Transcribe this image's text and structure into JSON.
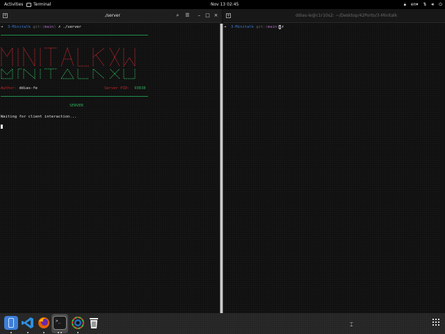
{
  "topbar": {
    "activities": "Activities",
    "app_name": "Terminal",
    "clock": "Nov 13  02:45",
    "lang": "en",
    "tray_icons": [
      "lock-icon",
      "keyboard-layout-icon",
      "network-icon",
      "volume-icon",
      "power-icon"
    ]
  },
  "terminal": {
    "left_tab": {
      "title": "./server"
    },
    "right_tab": {
      "title": "ddias-le@c1r10s2: ~/Desktop/42Porto/3-Minitalk"
    },
    "left_pane": {
      "prompt": {
        "arrow": "➜",
        "dir": "3-Minitalk",
        "git": "git:(",
        "branch": "main",
        "close": ")",
        "sep": "✗",
        "command": "./server"
      },
      "author_label": "Author:",
      "author_value": "ddias-fe",
      "pid_label": "Server PID:",
      "pid_value": "93838",
      "server_title": "SERVER",
      "status": "Waiting for client interaction..."
    },
    "right_pane": {
      "prompt": {
        "arrow": "➜",
        "dir": "3-Minitalk",
        "git": "git:(",
        "branch": "main",
        "close": ")",
        "sep": "✗"
      }
    }
  },
  "dock": {
    "items": [
      "files-icon",
      "vscode-icon",
      "firefox-icon",
      "terminal-icon",
      "color-picker-icon",
      "trash-icon"
    ],
    "running": [
      "files-icon",
      "vscode-icon",
      "firefox-icon",
      "terminal-icon",
      "color-picker-icon"
    ]
  },
  "colors": {
    "banner_red": "#c1272d",
    "banner_green": "#2fae5a",
    "prompt_blue": "#3a7bd5",
    "branch_purple": "#b06bc9"
  }
}
